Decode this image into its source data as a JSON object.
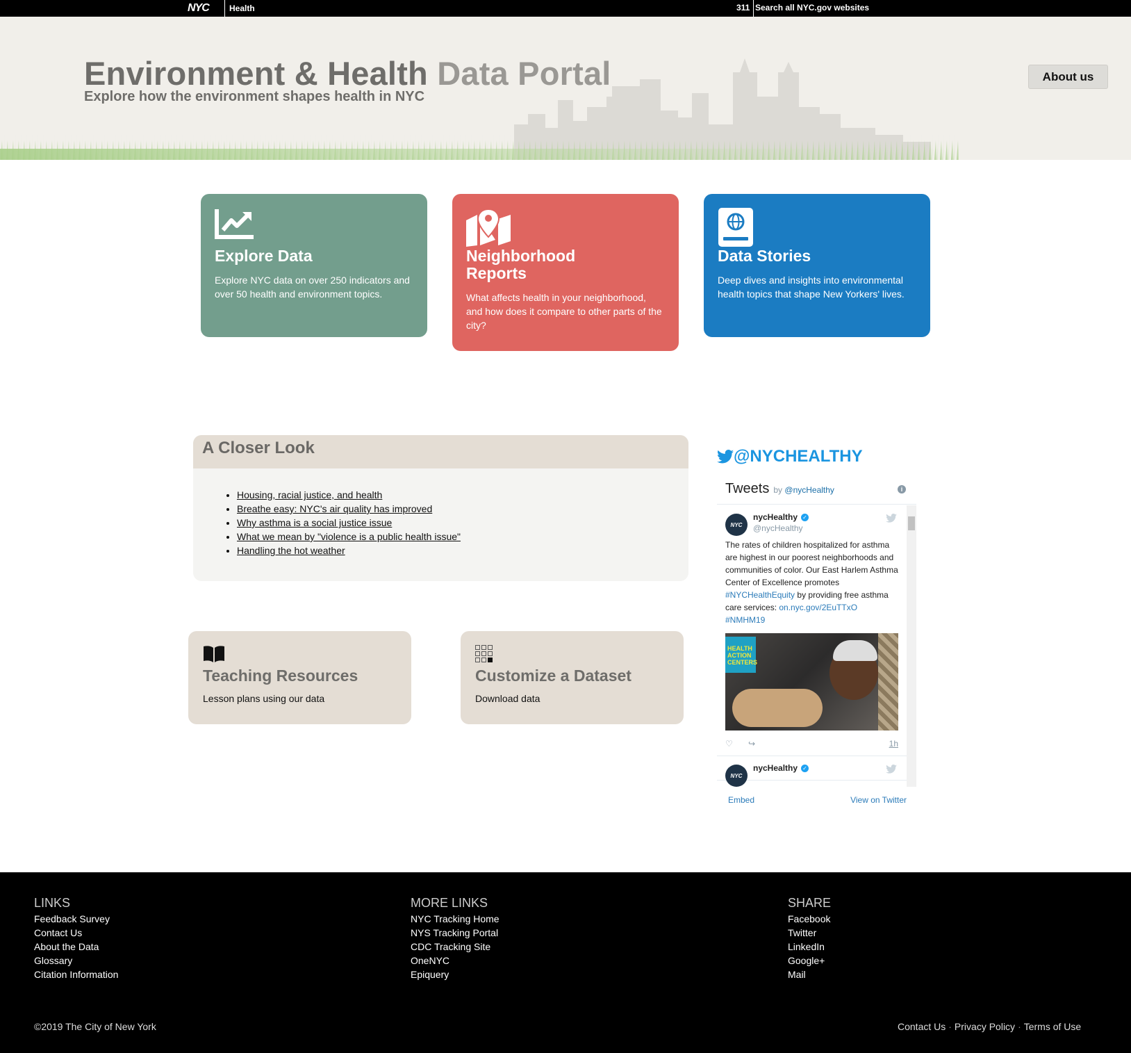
{
  "topbar": {
    "logo": "NYC",
    "agency": "Health",
    "phone": "311",
    "search": "Search all NYC.gov websites"
  },
  "hero": {
    "title_main": "Environment & Health",
    "title_light": " Data Portal",
    "subtitle": "Explore how the environment shapes health in NYC",
    "about_button": "About us"
  },
  "tiles": [
    {
      "title": "Explore Data",
      "desc": "Explore NYC data on over 250 indicators and over 50 health and environment topics.",
      "color": "#739e8d",
      "icon": "chart-line-icon"
    },
    {
      "title": "Neighborhood Reports",
      "desc": "What affects health in your neighborhood, and how does it compare to other parts of the city?",
      "color": "#df6560",
      "icon": "map-pin-icon"
    },
    {
      "title": "Data Stories",
      "desc": "Deep dives and insights into environmental health topics that shape New Yorkers' lives.",
      "color": "#1b7cc2",
      "icon": "globe-book-icon"
    }
  ],
  "closer_look": {
    "heading": "A Closer Look",
    "links": [
      "Housing, racial justice, and health",
      "Breathe easy: NYC's air quality has improved",
      "Why asthma is a social justice issue",
      "What we mean by \"violence is a public health issue\"",
      "Handling the hot weather"
    ]
  },
  "small_tiles": [
    {
      "title": "Teaching Resources",
      "desc": "Lesson plans using our data",
      "icon": "book-icon"
    },
    {
      "title": "Customize a Dataset",
      "desc": "Download data",
      "icon": "grid-icon"
    }
  ],
  "twitter": {
    "handle": "@NYCHEALTHY",
    "title": "Tweets",
    "by": "by",
    "by_handle": "@nycHealthy",
    "tweets": [
      {
        "name": "nycHealthy",
        "screen": "@nycHealthy",
        "text_a": "The rates of children hospitalized for asthma are highest in our poorest neighborhoods and communities of color. Our East Harlem Asthma Center of Excellence promotes ",
        "hashtag1": "#NYCHealthEquity",
        "text_b": " by providing free asthma care services: ",
        "link": "on.nyc.gov/2EuTTxO",
        "hashtag2": "#NMHM19",
        "badge": "HEALTH ACTION CENTERS",
        "time": "1h"
      },
      {
        "name": "nycHealthy"
      }
    ],
    "embed": "Embed",
    "view": "View on Twitter"
  },
  "footer": {
    "links_heading": "LINKS",
    "links": [
      "Feedback Survey",
      "Contact Us",
      "About the Data",
      "Glossary",
      "Citation Information"
    ],
    "more_heading": "MORE LINKS",
    "more": [
      "NYC Tracking Home",
      "NYS Tracking Portal",
      "CDC Tracking Site",
      "OneNYC",
      "Epiquery"
    ],
    "share_heading": "SHARE",
    "share": [
      "Facebook",
      "Twitter",
      "LinkedIn",
      "Google+",
      "Mail"
    ],
    "copyright": "©2019 The City of New York",
    "legal": [
      "Contact Us",
      "Privacy Policy",
      "Terms of Use"
    ]
  }
}
